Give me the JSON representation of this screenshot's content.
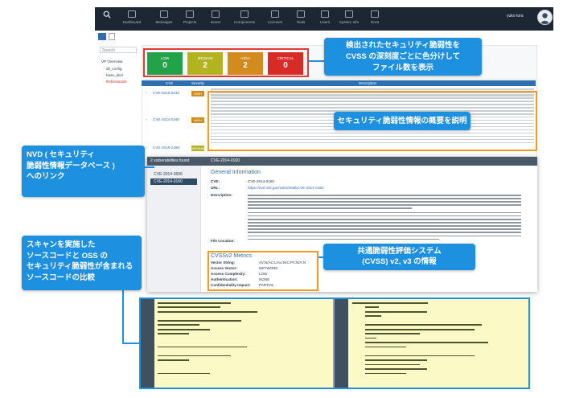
{
  "nav": {
    "items": [
      {
        "label": "Dashboard",
        "icon": "dashboard-icon"
      },
      {
        "label": "Messages",
        "icon": "mail-icon"
      },
      {
        "label": "Projects",
        "icon": "projects-icon"
      },
      {
        "label": "Scans",
        "icon": "scans-icon"
      },
      {
        "label": "Components",
        "icon": "components-icon"
      },
      {
        "label": "Licenses",
        "icon": "licenses-icon"
      },
      {
        "label": "Tools",
        "icon": "tools-icon"
      },
      {
        "label": "Users",
        "icon": "users-icon"
      },
      {
        "label": "System Info",
        "icon": "info-icon"
      },
      {
        "label": "Docs",
        "icon": "docs-icon"
      }
    ],
    "user": "yuko tora"
  },
  "sidebar": {
    "search_placeholder": "Search",
    "tree": [
      "VP Overview",
      "dil_config",
      "base_decl",
      "fileDeclarate"
    ]
  },
  "summary": {
    "cards": [
      {
        "label": "LOW",
        "count": "0",
        "color": "#22a34a"
      },
      {
        "label": "MEDIUM",
        "count": "2",
        "color": "#b3b21f"
      },
      {
        "label": "HIGH",
        "count": "2",
        "color": "#d28b1c"
      },
      {
        "label": "CRITICAL",
        "count": "0",
        "color": "#d62b26"
      }
    ]
  },
  "table": {
    "headers": [
      "CVE",
      "Severity",
      "Description"
    ],
    "rows": [
      {
        "id": "CVE-2016-2232",
        "severity": "HIGH",
        "color": "#d28b1c"
      },
      {
        "id": "CVE-2014-0160",
        "severity": "HIGH",
        "color": "#d28b1c"
      },
      {
        "id": "CVE-2016-2199",
        "severity": "MEDIUM",
        "color": "#b3b21f"
      }
    ]
  },
  "detail": {
    "panel_title": "2 vulnerabilities found",
    "list": [
      "CVE-2014-3606",
      "CVE-2014-0160"
    ],
    "header_title": "CVE-2014-0160",
    "general_title": "General Information",
    "fields": [
      {
        "key": "CVE:",
        "value": "CVE-2014-0160"
      },
      {
        "key": "URL:",
        "value": "https://nvd.nist.gov/vuln/detail/CVE-2014-0160"
      },
      {
        "key": "Description:",
        "value": ""
      }
    ],
    "file_label": "File Location:",
    "cvss_title": "CVSSv2 Metrics",
    "cvss": [
      {
        "key": "Vector String:",
        "value": "AV:N/AC:L/Au:N/C:P/I:N/A:N"
      },
      {
        "key": "Access Vector:",
        "value": "NETWORK"
      },
      {
        "key": "Access Complexity:",
        "value": "LOW"
      },
      {
        "key": "Authentication:",
        "value": "NONE"
      },
      {
        "key": "Confidentiality Impact:",
        "value": "PARTIAL"
      }
    ]
  },
  "callouts": {
    "c1": [
      "検出されたセキュリティ脆弱性を",
      "CVSS の深刻度ごとに色分けして",
      "ファイル数を表示"
    ],
    "c2": "セキュリティ脆弱性情報の概要を説明",
    "c3": [
      "NVD ( セキュリティ",
      "脆弱性情報データベース )",
      "へのリンク"
    ],
    "c4": [
      "共通脆弱性評価システム",
      "(CVSS) v2, v3 の情報"
    ],
    "c5": [
      "スキャンを実施した",
      "ソースコードと OSS の",
      "セキュリティ脆弱性が含まれる",
      "ソースコードの比較"
    ]
  }
}
